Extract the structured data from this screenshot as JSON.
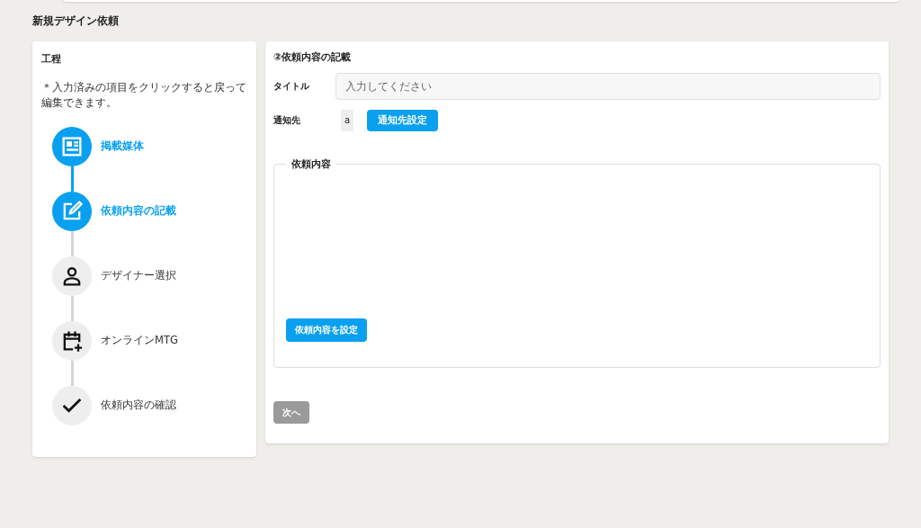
{
  "page_title": "新規デザイン依頼",
  "steps_panel": {
    "title": "工程",
    "note": "＊入力済みの項目をクリックすると戻って編集できます。",
    "steps": [
      {
        "label": "掲載媒体",
        "kind": "newspaper",
        "active": true
      },
      {
        "label": "依頼内容の記載",
        "kind": "edit",
        "active": true
      },
      {
        "label": "デザイナー選択",
        "kind": "person",
        "active": false
      },
      {
        "label": "オンラインMTG",
        "kind": "calendar",
        "active": false
      },
      {
        "label": "依頼内容の確認",
        "kind": "check",
        "active": false
      }
    ]
  },
  "form": {
    "heading": "②依頼内容の記載",
    "title_label": "タイトル",
    "title_placeholder": "入力してください",
    "notify_label": "通知先",
    "notify_value": "a",
    "notify_button": "通知先設定",
    "content_legend": "依頼内容",
    "content_button": "依頼内容を設定",
    "next_button": {
      "label": "次へ",
      "disabled": true
    }
  }
}
